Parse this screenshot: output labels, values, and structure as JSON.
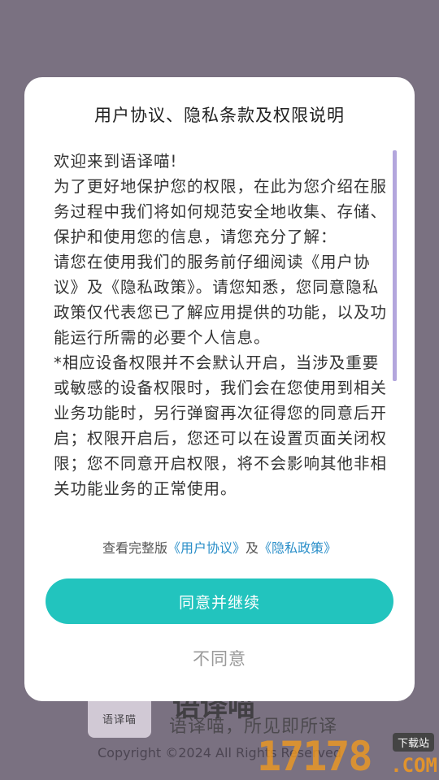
{
  "background": {
    "app_logo_text": "语译喵",
    "app_name": "语译喵",
    "slogan": "语译喵，所见即所译",
    "copyright": "Copyright ©2024 All Rights Reserved"
  },
  "dialog": {
    "title": "用户协议、隐私条款及权限说明",
    "body_paragraphs": [
      "欢迎来到语译喵!",
      "为了更好地保护您的权限，在此为您介绍在服务过程中我们将如何规范安全地收集、存储、保护和使用您的信息，请您充分了解：",
      "请您在使用我们的服务前仔细阅读《用户协议》及《隐私政策》。请您知悉，您同意隐私政策仅代表您已了解应用提供的功能，以及功能运行所需的必要个人信息。",
      "*相应设备权限并不会默认开启，当涉及重要或敏感的设备权限时，我们会在您使用到相关业务功能时，另行弹窗再次征得您的同意后开启；权限开启后，您还可以在设置页面关闭权限；您不同意开启权限，将不会影响其他非相关功能业务的正常使用。"
    ],
    "links": {
      "prefix": "查看完整版",
      "user_agreement": "《用户协议》",
      "conjunction": "及",
      "privacy_policy": "《隐私政策》"
    },
    "agree_button": "同意并继续",
    "disagree_button": "不同意"
  },
  "watermark": {
    "number": "17178",
    "badge": "下载站",
    "domain": ".COM"
  },
  "colors": {
    "overlay": "#7a7181",
    "accent": "#22c4be",
    "link": "#2b8fc9",
    "scrollbar": "#b3a6dd"
  }
}
